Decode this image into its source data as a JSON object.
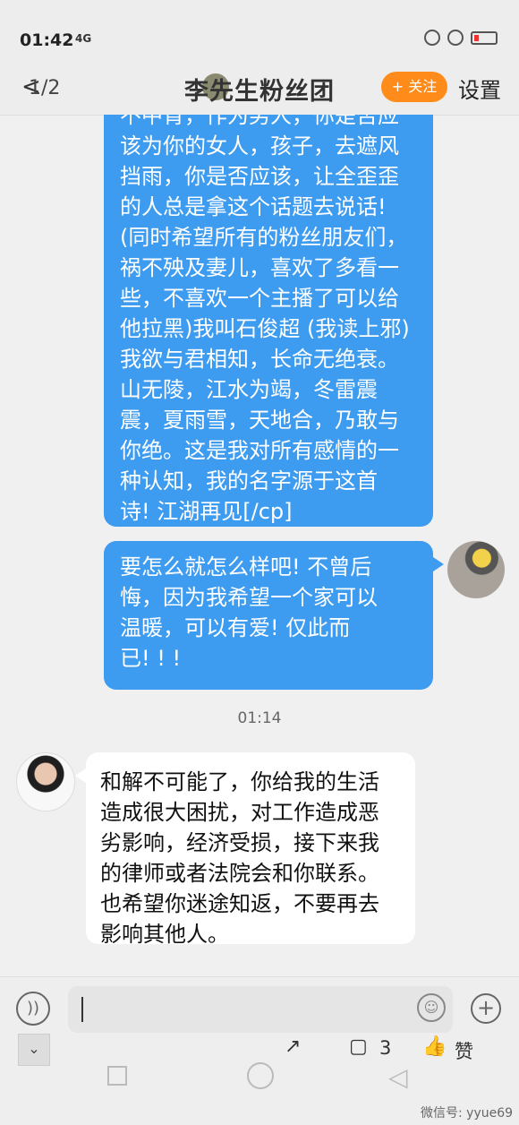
{
  "status": {
    "time": "01:42",
    "network": "4G"
  },
  "header": {
    "back_label": "<",
    "page_indicator": "1/2",
    "title": "李先生粉丝团",
    "follow_label": "+ 关注",
    "settings_label": "设置"
  },
  "messages": {
    "m1": "不中肯，作为男人，你是否应\n该为你的女人，孩子，去遮风\n挡雨，你是否应该，让全歪歪\n的人总是拿这个话题去说话!\n(同时希望所有的粉丝朋友们，\n祸不殃及妻儿，喜欢了多看一\n些，不喜欢一个主播了可以给\n他拉黑)我叫石俊超 (我读上邪)\n我欲与君相知，长命无绝衰。\n山无陵，江水为竭，冬雷震\n震，夏雨雪，天地合，乃敢与\n你绝。这是我对所有感情的一\n种认知，我的名字源于这首\n诗! 江湖再见[/cp]",
    "m2": "要怎么就怎么样吧! 不曾后\n悔，因为我希望一个家可以\n温暖，可以有爱! 仅此而\n已! ! !",
    "timestamp": "01:14",
    "m3": "和解不可能了，你给我的生活\n造成很大困扰，对工作造成恶\n劣影响，经济受损，接下来我\n的律师或者法院会和你联系。\n也希望你迷途知返，不要再去\n影响其他人。"
  },
  "composer": {
    "voice_icon": "voice-icon",
    "emoji_icon": "emoji-icon",
    "plus_icon": "plus-icon"
  },
  "toolbar": {
    "collapse_label": "⌄",
    "share_label": "↗",
    "comment_label": "▢",
    "comment_count": "3",
    "like_label": "👍",
    "like_text": "赞"
  },
  "watermark": "微信号: yyue69"
}
